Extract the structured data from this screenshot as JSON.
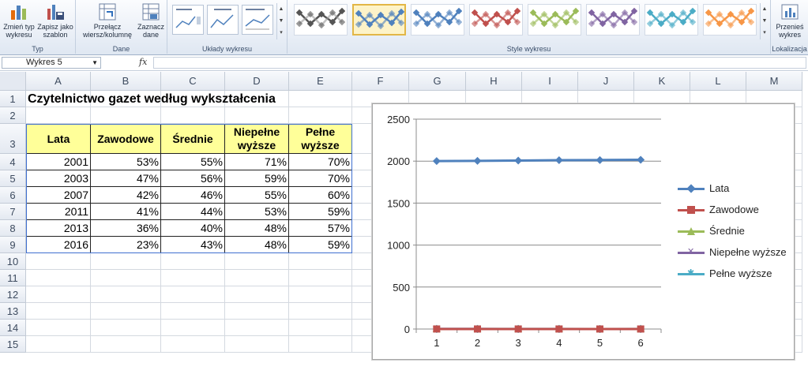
{
  "ribbon": {
    "groups": [
      {
        "label": "Typ",
        "buttons": [
          {
            "label": "Zmień typ wykresu"
          },
          {
            "label": "Zapisz jako szablon"
          }
        ]
      },
      {
        "label": "Dane",
        "buttons": [
          {
            "label": "Przełącz wiersz/kolumnę"
          },
          {
            "label": "Zaznacz dane"
          }
        ]
      },
      {
        "label": "Układy wykresu"
      },
      {
        "label": "Style wykresu"
      },
      {
        "label": "Lokalizacja",
        "buttons": [
          {
            "label": "Przenieś wykres"
          }
        ]
      }
    ],
    "style_colors": [
      "#555555",
      "#4f81bd",
      "#4f81bd",
      "#c0504d",
      "#9bbb59",
      "#8064a2",
      "#4bacc6",
      "#f79646"
    ]
  },
  "formula_bar": {
    "name_box": "Wykres 5",
    "fx": "fx",
    "formula": ""
  },
  "columns": [
    "A",
    "B",
    "C",
    "D",
    "E",
    "F",
    "G",
    "H",
    "I",
    "J",
    "K",
    "L",
    "M"
  ],
  "rows": [
    "1",
    "2",
    "3",
    "4",
    "5",
    "6",
    "7",
    "8",
    "9",
    "10",
    "11",
    "12",
    "13",
    "14",
    "15"
  ],
  "sheet": {
    "title": "Czytelnictwo gazet według wykształcenia",
    "headers": [
      "Lata",
      "Zawodowe",
      "Średnie",
      "Niepełne wyższe",
      "Pełne wyższe"
    ],
    "data": [
      [
        "2001",
        "53%",
        "55%",
        "71%",
        "70%"
      ],
      [
        "2003",
        "47%",
        "56%",
        "59%",
        "70%"
      ],
      [
        "2007",
        "42%",
        "46%",
        "55%",
        "60%"
      ],
      [
        "2011",
        "41%",
        "44%",
        "53%",
        "59%"
      ],
      [
        "2013",
        "36%",
        "40%",
        "48%",
        "57%"
      ],
      [
        "2016",
        "23%",
        "43%",
        "48%",
        "59%"
      ]
    ]
  },
  "chart_data": {
    "type": "line",
    "x": [
      1,
      2,
      3,
      4,
      5,
      6
    ],
    "y_ticks": [
      0,
      500,
      1000,
      1500,
      2000,
      2500
    ],
    "ylim": [
      0,
      2500
    ],
    "grid": true,
    "legend": "right",
    "series": [
      {
        "name": "Lata",
        "values": [
          2001,
          2003,
          2007,
          2011,
          2013,
          2016
        ],
        "color": "#4f81bd",
        "marker": "diamond"
      },
      {
        "name": "Zawodowe",
        "values": [
          0.53,
          0.47,
          0.42,
          0.41,
          0.36,
          0.23
        ],
        "color": "#c0504d",
        "marker": "square"
      },
      {
        "name": "Średnie",
        "values": [
          0.55,
          0.56,
          0.46,
          0.44,
          0.4,
          0.43
        ],
        "color": "#9bbb59",
        "marker": "triangle"
      },
      {
        "name": "Niepełne wyższe",
        "values": [
          0.71,
          0.59,
          0.55,
          0.53,
          0.48,
          0.48
        ],
        "color": "#8064a2",
        "marker": "x"
      },
      {
        "name": "Pełne wyższe",
        "values": [
          0.7,
          0.7,
          0.6,
          0.59,
          0.57,
          0.59
        ],
        "color": "#4bacc6",
        "marker": "star"
      }
    ]
  }
}
